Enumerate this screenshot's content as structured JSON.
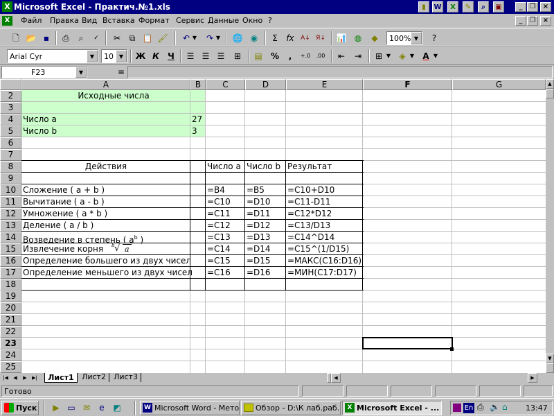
{
  "window": {
    "title": "Microsoft Excel - Практич.№1.xls"
  },
  "menu": [
    "Файл",
    "Правка",
    "Вид",
    "Вставка",
    "Формат",
    "Сервис",
    "Данные",
    "Окно",
    "?"
  ],
  "font_box": {
    "name": "Arial Cyr",
    "size": "10"
  },
  "zoom": "100%",
  "format_buttons": {
    "bold": "Ж",
    "italic": "К",
    "underline": "Ч",
    "percent": "%",
    "comma": ","
  },
  "formula_bar": {
    "name_box": "F23",
    "equals": "="
  },
  "columns": [
    "A",
    "B",
    "C",
    "D",
    "E",
    "F",
    "G"
  ],
  "rows": [
    "2",
    "3",
    "4",
    "5",
    "6",
    "7",
    "8",
    "9",
    "10",
    "11",
    "12",
    "13",
    "14",
    "15",
    "16",
    "17",
    "18",
    "19",
    "20",
    "21",
    "22",
    "23",
    "24",
    "25"
  ],
  "cells": {
    "a2": "Исходные числа",
    "a4": "Число a",
    "b4": "27",
    "a5": "Число b",
    "b5": "3",
    "a8": "Действия",
    "c8": "Число a",
    "d8": "Число b",
    "e8": "Результат",
    "a10": "Сложение   ( a + b )",
    "c10": "=B4",
    "d10": "=B5",
    "e10": "=C10+D10",
    "a11": "Вычитание  ( a - b )",
    "c11": "=C10",
    "d11": "=D10",
    "e11": "=C11-D11",
    "a12": "Умножение  ( a * b )",
    "c12": "=C11",
    "d12": "=D11",
    "e12": "=C12*D12",
    "a13": "Деление     ( a / b )",
    "c13": "=C12",
    "d13": "=D12",
    "e13": "=C13/D13",
    "a14": "Возведение в степень ( a",
    "a14_sup": "b",
    "a14_end": " )",
    "c14": "=C13",
    "d14": "=D13",
    "e14": "=C14^D14",
    "a15": "Извлечение корня",
    "a15_root_index": "b",
    "a15_root_arg": "a",
    "c15": "=C14",
    "d15": "=D14",
    "e15": "=C15^(1/D15)",
    "a16": "Определение большего из двух чисел",
    "c16": "=C15",
    "d16": "=D15",
    "e16": "=МАКС(C16:D16)",
    "a17": "Определение меньшего из двух чисел",
    "c17": "=C16",
    "d17": "=D16",
    "e17": "=МИН(C17:D17)"
  },
  "colors": {
    "highlight": "#ccffcc",
    "titlebar": "#000080"
  },
  "sheets": [
    "Лист1",
    "Лист2",
    "Лист3"
  ],
  "status": "Готово",
  "taskbar": {
    "start": "Пуск",
    "tasks": [
      "Microsoft Word - Мето...",
      "Обзор - D:\\К лаб.раб...",
      "Microsoft Excel - ..."
    ],
    "lang": "En",
    "clock": "13:47"
  }
}
